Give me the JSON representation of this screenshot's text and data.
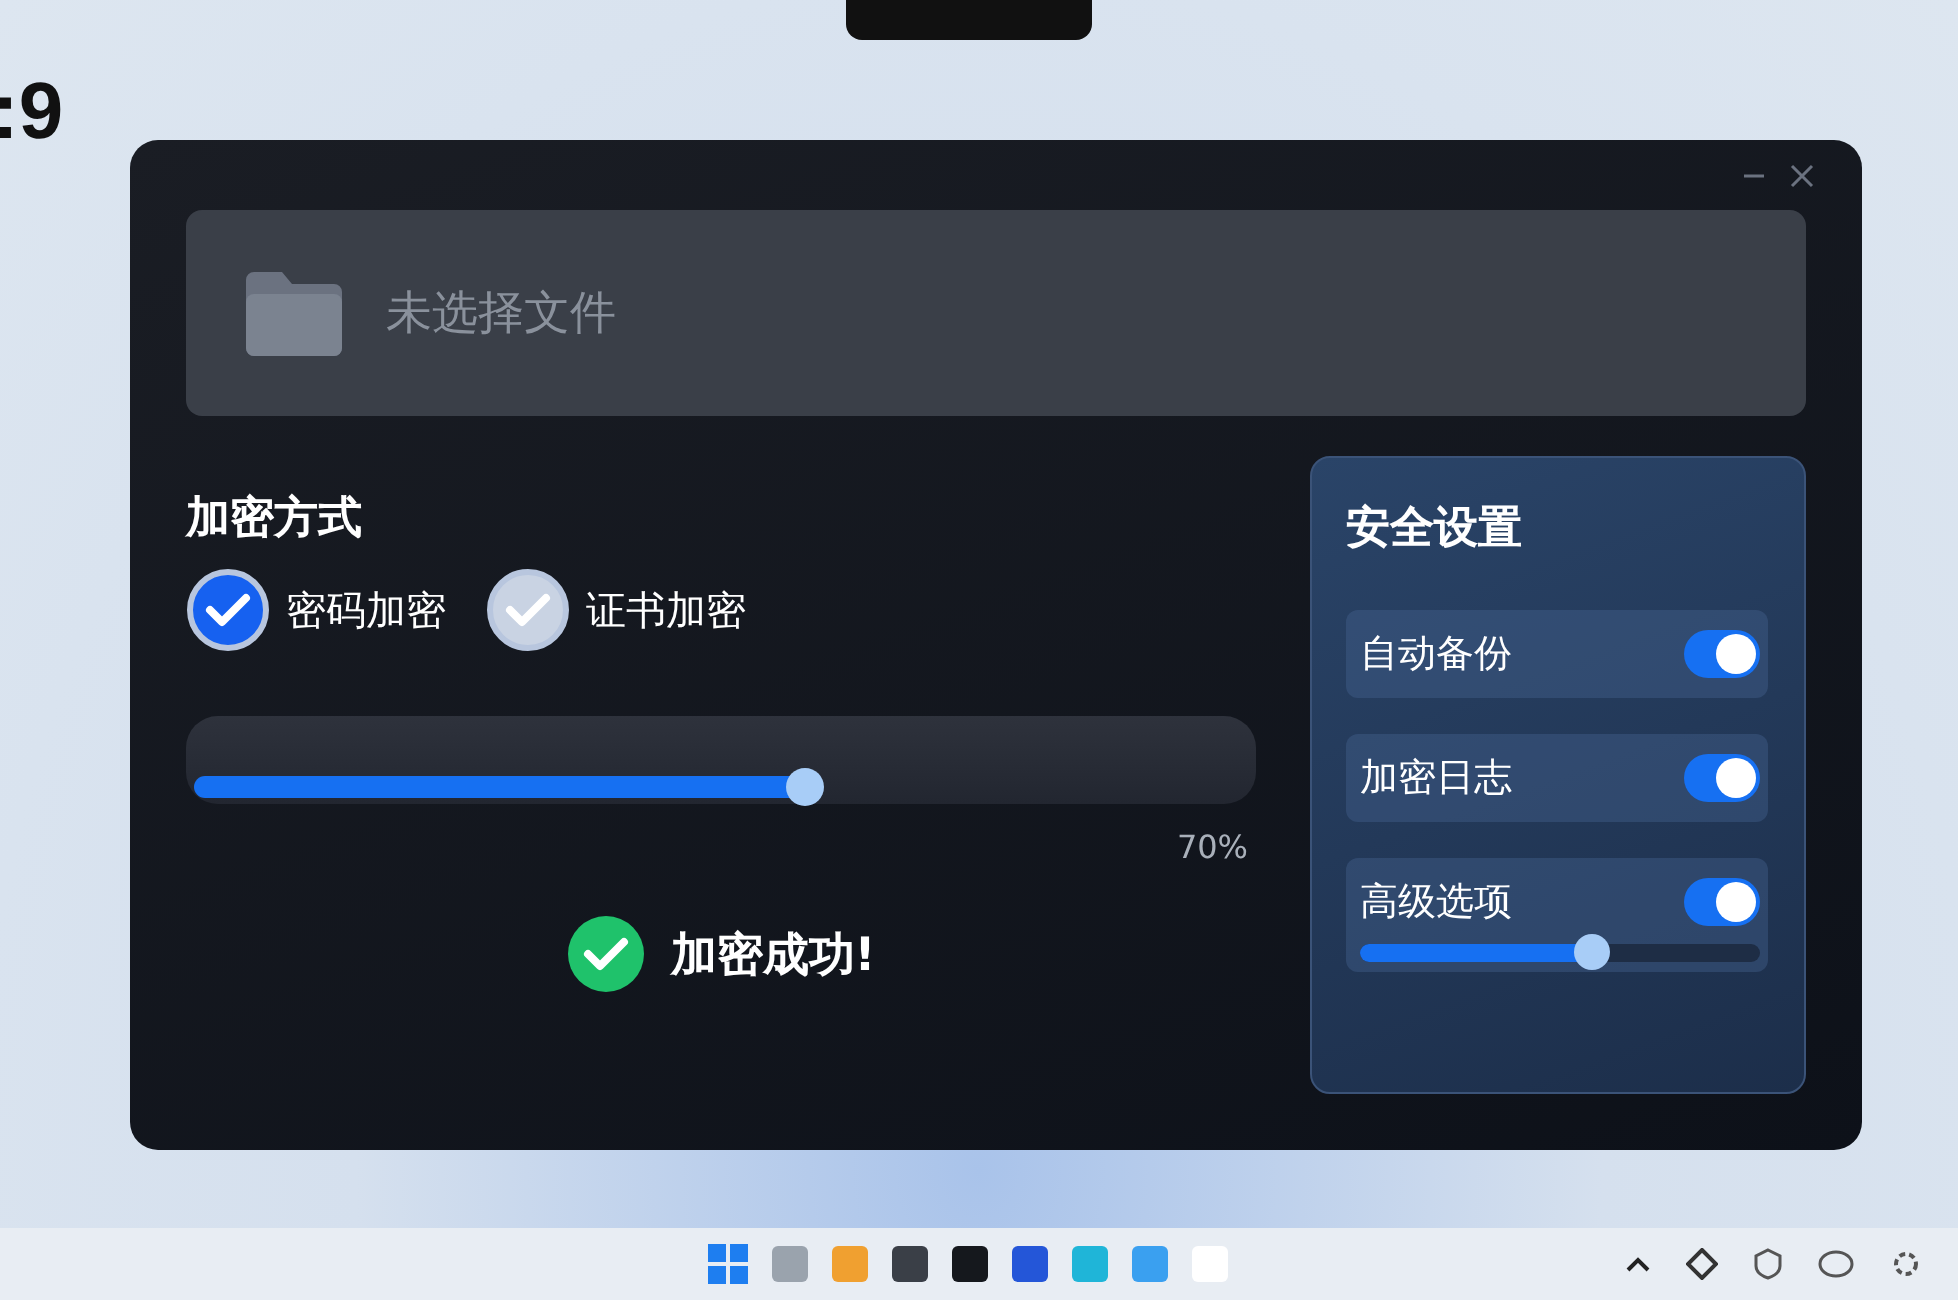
{
  "desktop": {
    "clock_fragment": ":9"
  },
  "window": {
    "file_picker": {
      "label": "未选择文件"
    },
    "method": {
      "title": "加密方式",
      "options": [
        {
          "label": "密码加密",
          "selected": true
        },
        {
          "label": "证书加密",
          "selected": false
        }
      ]
    },
    "progress": {
      "level": 0.58,
      "reading": "70%"
    },
    "status": {
      "text": "加密成功!"
    },
    "settings": {
      "title": "安全设置",
      "items": [
        {
          "label": "自动备份",
          "on": true
        },
        {
          "label": "加密日志",
          "on": true
        },
        {
          "label": "高级选项",
          "on": true,
          "slider": {
            "level": 0.58
          }
        }
      ]
    }
  }
}
